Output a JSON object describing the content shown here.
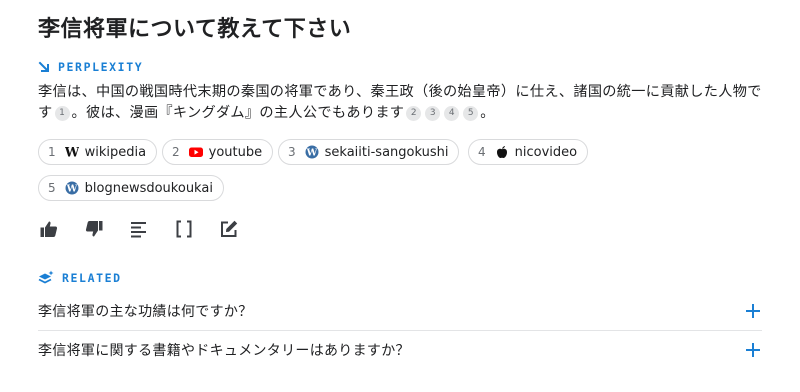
{
  "question": "李信将軍について教えて下さい",
  "perplexity_label": "PERPLEXITY",
  "answer": {
    "part1": "李信は、中国の戦国時代末期の秦国の将軍であり、秦王政（後の始皇帝）に仕え、諸国の統一に貢献した人物です",
    "cite1": "1",
    "part2": "。彼は、漫画『キングダム』の主人公でもあります",
    "cite2": "2",
    "cite3": "3",
    "cite4": "4",
    "cite5": "5",
    "part3": "。"
  },
  "sources": [
    {
      "num": "1",
      "name": "wikipedia",
      "icon": "wikipedia-icon"
    },
    {
      "num": "2",
      "name": "youtube",
      "icon": "youtube-icon"
    },
    {
      "num": "3",
      "name": "sekaiiti-sangokushi",
      "icon": "wordpress-icon"
    },
    {
      "num": "4",
      "name": "nicovideo",
      "icon": "nicovideo-icon"
    },
    {
      "num": "5",
      "name": "blognewsdoukoukai",
      "icon": "wordpress-icon"
    }
  ],
  "actions": [
    "thumbs-up-icon",
    "thumbs-down-icon",
    "text-lines-icon",
    "brackets-icon",
    "edit-icon"
  ],
  "related_label": "RELATED",
  "related": [
    "李信将軍の主な功績は何ですか？",
    "李信将軍に関する書籍やドキュメンタリーはありますか？"
  ],
  "colors": {
    "accent": "#1a7fd4",
    "text": "#202123",
    "chip_border": "#d9dadc"
  }
}
